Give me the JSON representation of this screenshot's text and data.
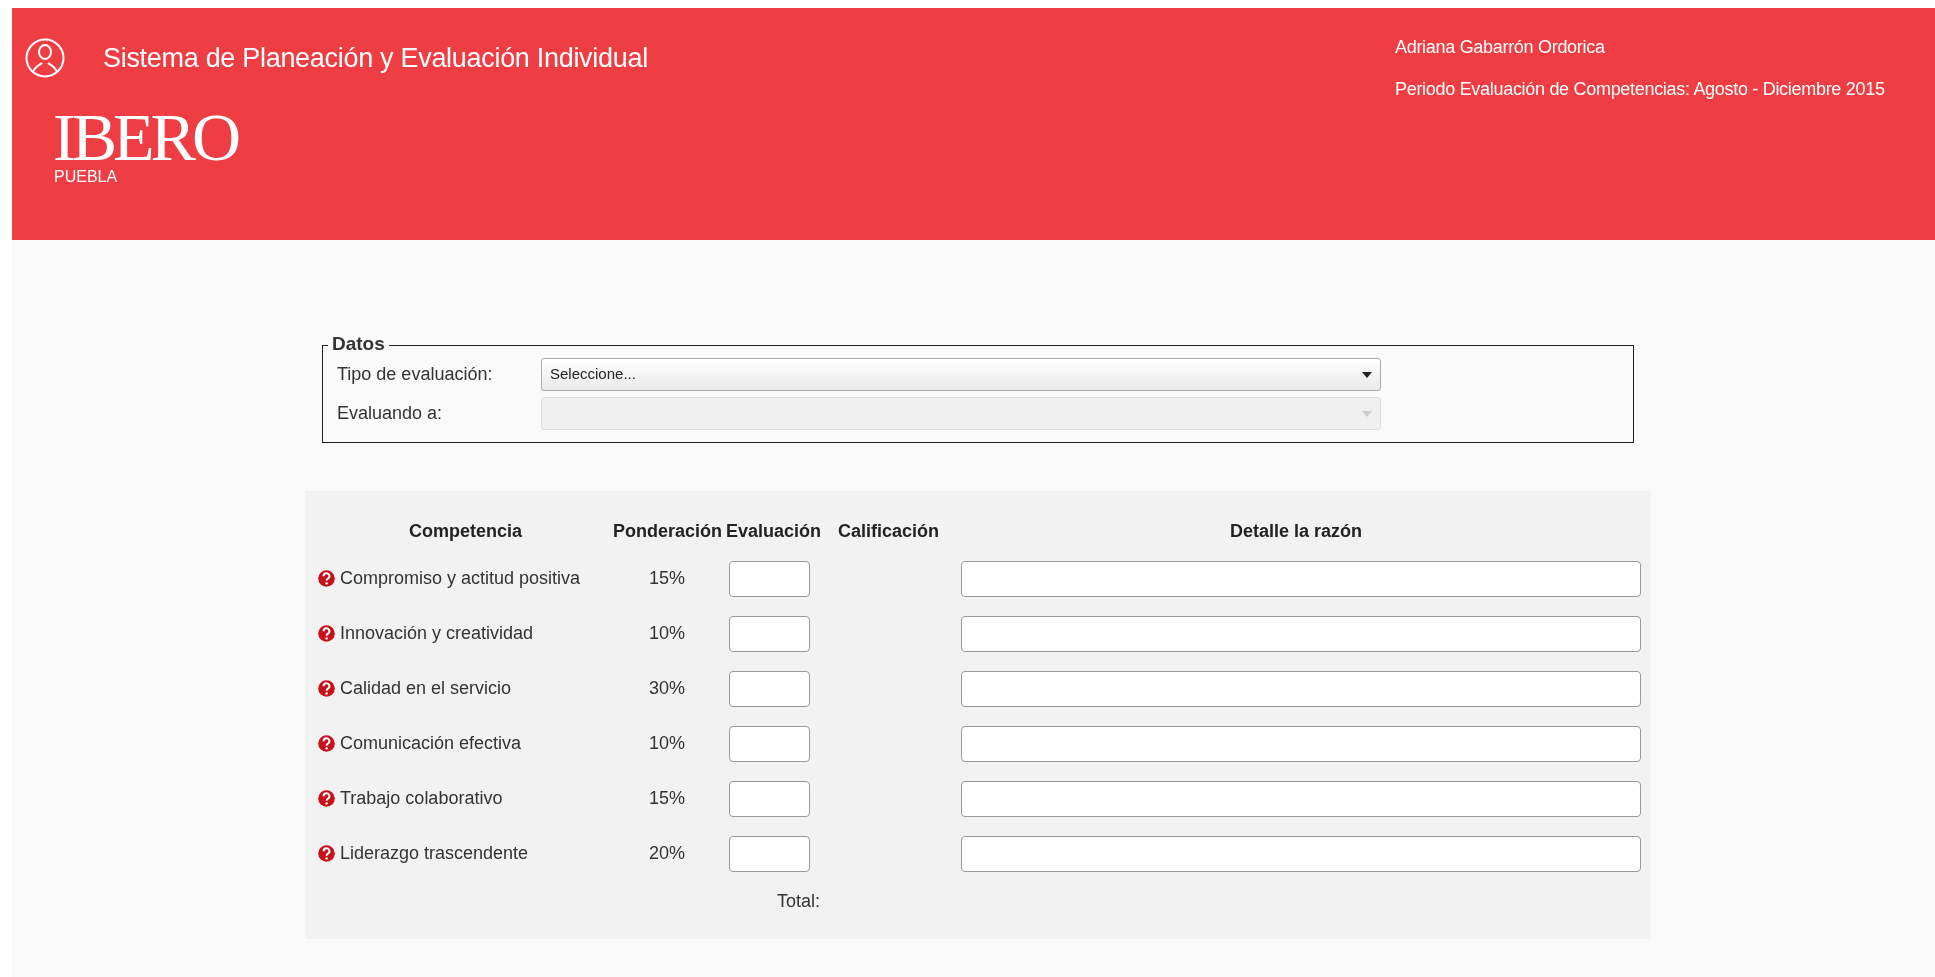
{
  "header": {
    "title": "Sistema de Planeación y Evaluación Individual",
    "logo": {
      "word": "IBERO",
      "sub": "PUEBLA"
    },
    "user_name": "Adriana Gabarrón Ordorica",
    "period": "Periodo Evaluación de Competencias: Agosto - Diciembre 2015"
  },
  "datos": {
    "legend": "Datos",
    "fields": [
      {
        "label": "Tipo de evaluación:",
        "value": "Seleccione...",
        "disabled": false
      },
      {
        "label": "Evaluando a:",
        "disabled": true
      }
    ]
  },
  "table": {
    "columns": [
      "Competencia",
      "Ponderación",
      "Evaluación",
      "Calificación",
      "Detalle la razón"
    ],
    "rows": [
      {
        "competencia": "Compromiso y actitud positiva",
        "ponderacion": "15%"
      },
      {
        "competencia": "Innovación y creatividad",
        "ponderacion": "10%"
      },
      {
        "competencia": "Calidad en el servicio",
        "ponderacion": "30%"
      },
      {
        "competencia": "Comunicación efectiva",
        "ponderacion": "10%"
      },
      {
        "competencia": "Trabajo colaborativo",
        "ponderacion": "15%"
      },
      {
        "competencia": "Liderazgo trascendente",
        "ponderacion": "20%"
      }
    ],
    "total_label": "Total:"
  }
}
